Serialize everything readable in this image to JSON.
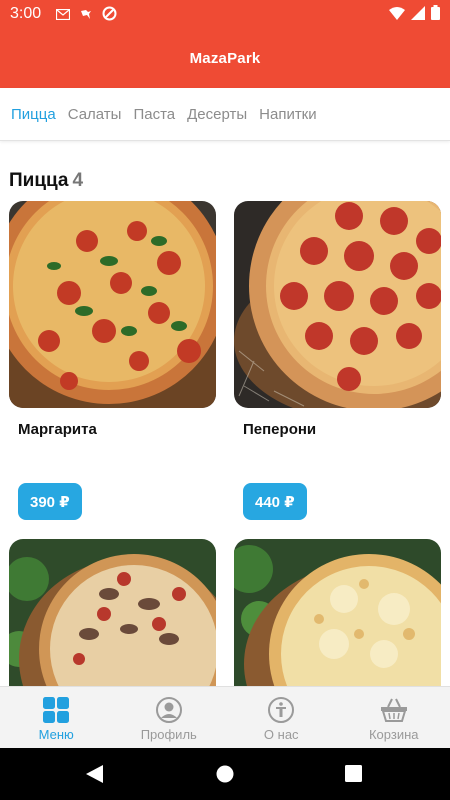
{
  "status_bar": {
    "time": "3:00"
  },
  "app": {
    "title": "MazaPark"
  },
  "tabs": [
    {
      "label": "Пицца",
      "active": true
    },
    {
      "label": "Салаты",
      "active": false
    },
    {
      "label": "Паста",
      "active": false
    },
    {
      "label": "Десерты",
      "active": false
    },
    {
      "label": "Напитки",
      "active": false
    }
  ],
  "section": {
    "title": "Пицца",
    "count": "4"
  },
  "products": [
    {
      "name": "Маргарита",
      "price": "390 ₽",
      "image": "pizza-margherita"
    },
    {
      "name": "Пеперони",
      "price": "440 ₽",
      "image": "pizza-pepperoni"
    },
    {
      "name": "",
      "price": "",
      "image": "pizza-mushroom"
    },
    {
      "name": "",
      "price": "",
      "image": "pizza-four-cheese"
    }
  ],
  "bottom_nav": [
    {
      "label": "Меню",
      "icon": "grid-icon",
      "active": true
    },
    {
      "label": "Профиль",
      "icon": "profile-icon",
      "active": false
    },
    {
      "label": "О нас",
      "icon": "info-icon",
      "active": false
    },
    {
      "label": "Корзина",
      "icon": "basket-icon",
      "active": false
    }
  ],
  "colors": {
    "brand": "#ef4b34",
    "accent": "#22a0df",
    "price_button": "#27a7e1"
  }
}
